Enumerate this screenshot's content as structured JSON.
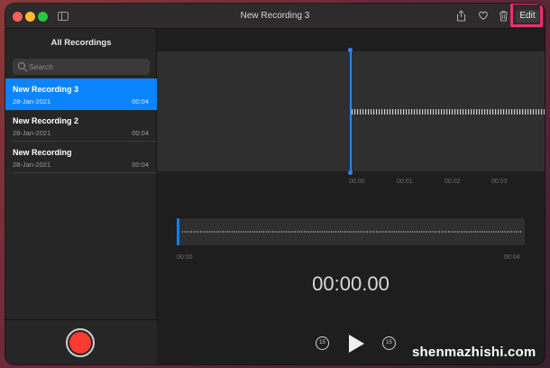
{
  "window": {
    "title": "New Recording 3"
  },
  "toolbar": {
    "share_icon": "share-icon",
    "favorite_icon": "heart-icon",
    "delete_icon": "trash-icon",
    "edit_label": "Edit",
    "highlight_color": "#e8336b"
  },
  "sidebar": {
    "heading": "All Recordings",
    "search": {
      "placeholder": "Search",
      "value": ""
    },
    "recordings": [
      {
        "name": "New Recording 3",
        "date": "28-Jan-2021",
        "duration": "00:04",
        "selected": true
      },
      {
        "name": "New Recording 2",
        "date": "28-Jan-2021",
        "duration": "00:04",
        "selected": false
      },
      {
        "name": "New Recording",
        "date": "28-Jan-2021",
        "duration": "00:04",
        "selected": false
      }
    ],
    "record_button_color": "#fe3b30"
  },
  "waveform": {
    "ticks": [
      "00:00",
      "00:01",
      "00:02",
      "00:03"
    ],
    "overview_start": "00:00",
    "overview_end": "00:04",
    "accent_color": "#0a84ff"
  },
  "player": {
    "time": "00:00.00",
    "skip_back_label": "15",
    "skip_forward_label": "15"
  },
  "watermark": "shenmazhishi.com"
}
